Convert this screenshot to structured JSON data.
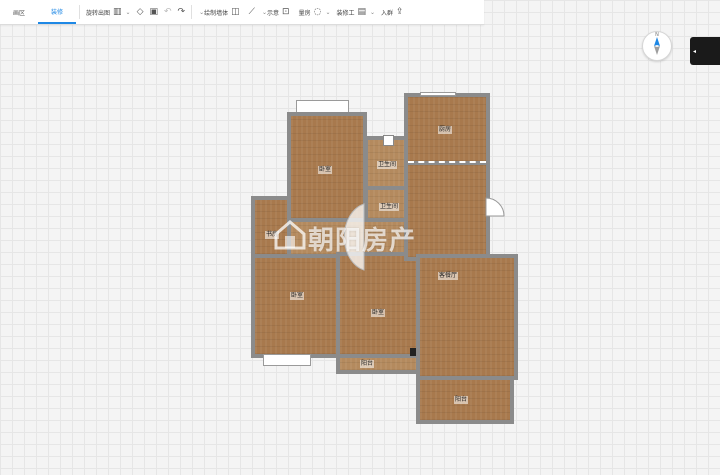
{
  "toolbar": {
    "tabs": [
      {
        "label": "画区",
        "active": false
      },
      {
        "label": "装修",
        "active": true
      }
    ],
    "items": [
      {
        "label": "旋转出图",
        "icon": "map-icon"
      },
      {
        "label": "",
        "icon": "eraser-icon"
      },
      {
        "label": "",
        "icon": "save-icon"
      },
      {
        "label": "",
        "icon": "undo-icon"
      },
      {
        "label": "",
        "icon": "redo-icon"
      },
      {
        "label": "绘制墙体",
        "icon": "wall-icon"
      },
      {
        "label": "",
        "icon": "ruler-icon"
      },
      {
        "label": "示意",
        "icon": "sketch-icon"
      },
      {
        "label": "量房",
        "icon": "measure-icon"
      },
      {
        "label": "装修工",
        "icon": "clipboard-icon"
      },
      {
        "label": "入群",
        "icon": "upload-icon"
      }
    ]
  },
  "compass": {
    "label": "N"
  },
  "watermark": "朝阳房产",
  "rooms": {
    "bedroom_top": "卧室",
    "kitchen": "厨房",
    "bath1": "卫生间",
    "bath2": "卫生间",
    "study": "书房",
    "bedroom_left": "卧室",
    "bedroom_mid": "卧室",
    "living": "客餐厅",
    "balcony_small": "阳台",
    "balcony": "阳台"
  },
  "colors": {
    "accent": "#1e88e5",
    "floor": "#a8794d",
    "wall": "#8b8b8b"
  }
}
